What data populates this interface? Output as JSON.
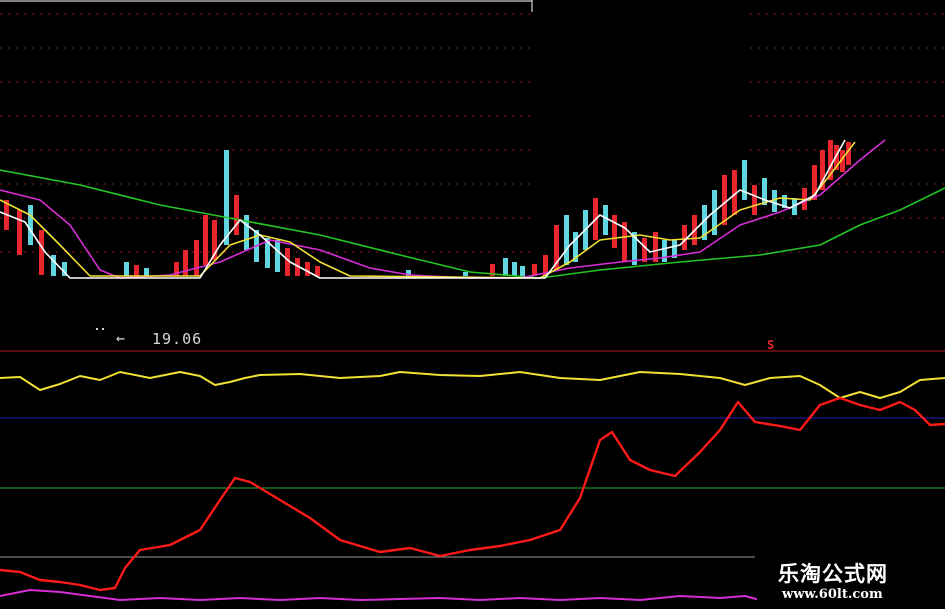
{
  "price_marker": {
    "value_label": "19.06",
    "arrow": "left-arrow-icon"
  },
  "signal": {
    "label": "S"
  },
  "watermark": {
    "title": "乐淘公式网",
    "url": "www.60lt.com"
  },
  "colors": {
    "background": "#000000",
    "up_candle": "#e8262e",
    "down_candle": "#5fd6e0",
    "ma_white": "#ffffff",
    "ma_yellow": "#f2e033",
    "ma_magenta": "#d62ed6",
    "ma_green": "#25c425",
    "indicator_yellow": "#f2e033",
    "indicator_red": "#ff1a1a",
    "indicator_magenta": "#d62ed6",
    "ref_red": "#b01818",
    "ref_blue": "#2020c0",
    "ref_green": "#20b020",
    "ref_gray": "#9a9a9a"
  },
  "chart_data": {
    "type": "line",
    "panels": [
      {
        "name": "",
        "kind": "candlestick",
        "up_flags": [
          1,
          1,
          0,
          1,
          0,
          0,
          0,
          1,
          0,
          1,
          1,
          1,
          1,
          1,
          0,
          1,
          0,
          0,
          0,
          0,
          1,
          1,
          1,
          1,
          0,
          0,
          1,
          0,
          0,
          0,
          1,
          1,
          1,
          0,
          0,
          0,
          1,
          0,
          1,
          1,
          0,
          1,
          1,
          0,
          0,
          1,
          1,
          0,
          0,
          1,
          1,
          0,
          1,
          0,
          0,
          0,
          0,
          1,
          1,
          1,
          1,
          1,
          1,
          1
        ],
        "moving_average_series": [
          {
            "color_key": "ma_white"
          },
          {
            "color_key": "ma_yellow"
          },
          {
            "color_key": "ma_magenta"
          },
          {
            "color_key": "ma_green"
          }
        ]
      },
      {
        "name": "",
        "kind": "indicator",
        "series": [
          {
            "color_key": "indicator_yellow"
          },
          {
            "color_key": "indicator_red"
          },
          {
            "color_key": "indicator_magenta"
          }
        ],
        "reference_lines": [
          "ref_red",
          "ref_blue",
          "ref_green",
          "ref_gray"
        ]
      }
    ]
  }
}
